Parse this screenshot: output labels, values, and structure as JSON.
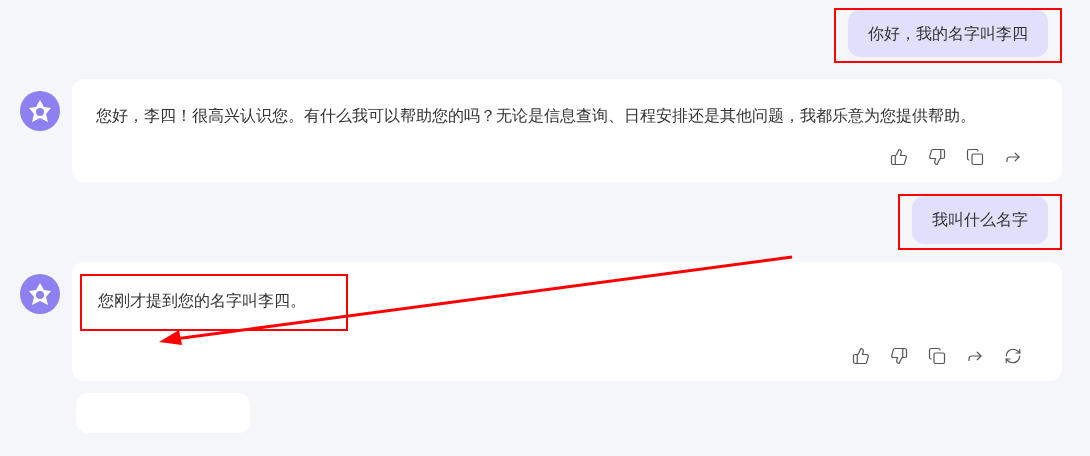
{
  "messages": [
    {
      "kind": "user",
      "text": "你好，我的名字叫李四",
      "highlighted": true
    },
    {
      "kind": "assistant",
      "text": "您好，李四！很高兴认识您。有什么我可以帮助您的吗？无论是信息查询、日程安排还是其他问题，我都乐意为您提供帮助。",
      "highlighted": false,
      "regenerate": false
    },
    {
      "kind": "user",
      "text": "我叫什么名字",
      "highlighted": true
    },
    {
      "kind": "assistant",
      "text": "您刚才提到您的名字叫李四。",
      "highlighted": true,
      "regenerate": true
    }
  ],
  "arrow_annotation": true
}
